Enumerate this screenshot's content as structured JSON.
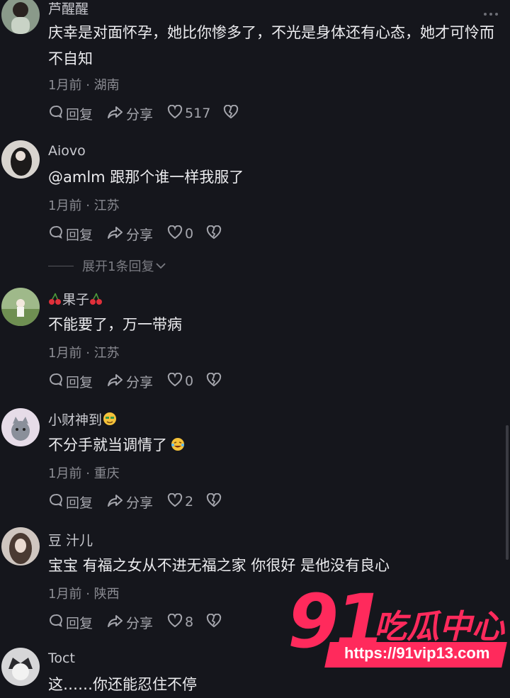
{
  "comments": [
    {
      "username": "芦醒醒",
      "text": "庆幸是对面怀孕，她比你惨多了，不光是身体还有心态，她才可怜而不自知",
      "time": "1月前",
      "location": "湖南",
      "reply_label": "回复",
      "share_label": "分享",
      "likes": "517"
    },
    {
      "username": "Aiovo",
      "text": "@amlm 跟那个谁一样我服了",
      "time": "1月前",
      "location": "江苏",
      "reply_label": "回复",
      "share_label": "分享",
      "likes": "0",
      "expand_label": "展开1条回复"
    },
    {
      "username": "果子",
      "text": "不能要了，万一带病",
      "time": "1月前",
      "location": "江苏",
      "reply_label": "回复",
      "share_label": "分享",
      "likes": "0"
    },
    {
      "username": "小财神到",
      "text": "不分手就当调情了",
      "time": "1月前",
      "location": "重庆",
      "reply_label": "回复",
      "share_label": "分享",
      "likes": "2"
    },
    {
      "username": "豆 汁儿",
      "text": "宝宝 有福之女从不进无福之家 你很好 是他没有良心",
      "time": "1月前",
      "location": "陕西",
      "reply_label": "回复",
      "share_label": "分享",
      "likes": "8"
    },
    {
      "username": "Toct",
      "text": "这……你还能忍住不停"
    }
  ],
  "separator": "·",
  "watermark": {
    "big": "91",
    "brand": "吃瓜中心",
    "url": "https://91vip13.com"
  },
  "colors": {
    "background": "#15161c",
    "watermark": "#ff2a5c"
  }
}
